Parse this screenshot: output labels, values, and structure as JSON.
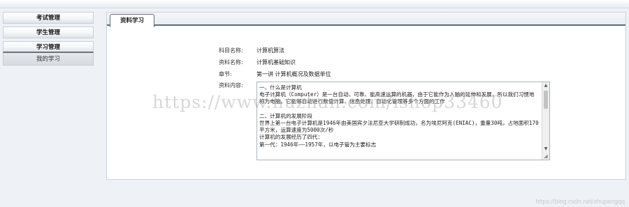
{
  "sidebar": {
    "items": [
      {
        "label": "考试管理"
      },
      {
        "label": "学生管理"
      },
      {
        "label": "学习管理"
      }
    ],
    "sub_items": [
      {
        "label": "我的学习"
      }
    ]
  },
  "tab": {
    "label": "资料学习"
  },
  "form": {
    "subject_label": "科目名称:",
    "subject_value": "计算机算法",
    "material_label": "资料名称:",
    "material_value": "计算机基础知识",
    "chapter_label": "章节:",
    "chapter_value": "第一讲 计算机概况及数据单位",
    "content_label": "资料内容:",
    "content_text": "一、什么是计算机\n电子计算机（Computer）是一台自动、可靠、能高速运算的机器，由于它能作为人脑的延伸和发展，所以我们习惯地称为电脑。它能够自动进行数值计算、信息处理、自动化管理等多个方面的工作\n\n二、计算机的发展阶段\n世界上第一台电子计算机是1946年由美国宾夕法尼亚大学研制成功，名为埃尼阿克(ENIAC)，重量30吨，占地面积170平方米，运算速度为5000次/秒\n计算机的发展经历了四代：\n第一代：1946年——1957年，以电子管为主要标志"
  },
  "watermark": "https://www.huzhan.com/ishop33460",
  "credit": "https://blog.csdn.net/zhupengqq"
}
